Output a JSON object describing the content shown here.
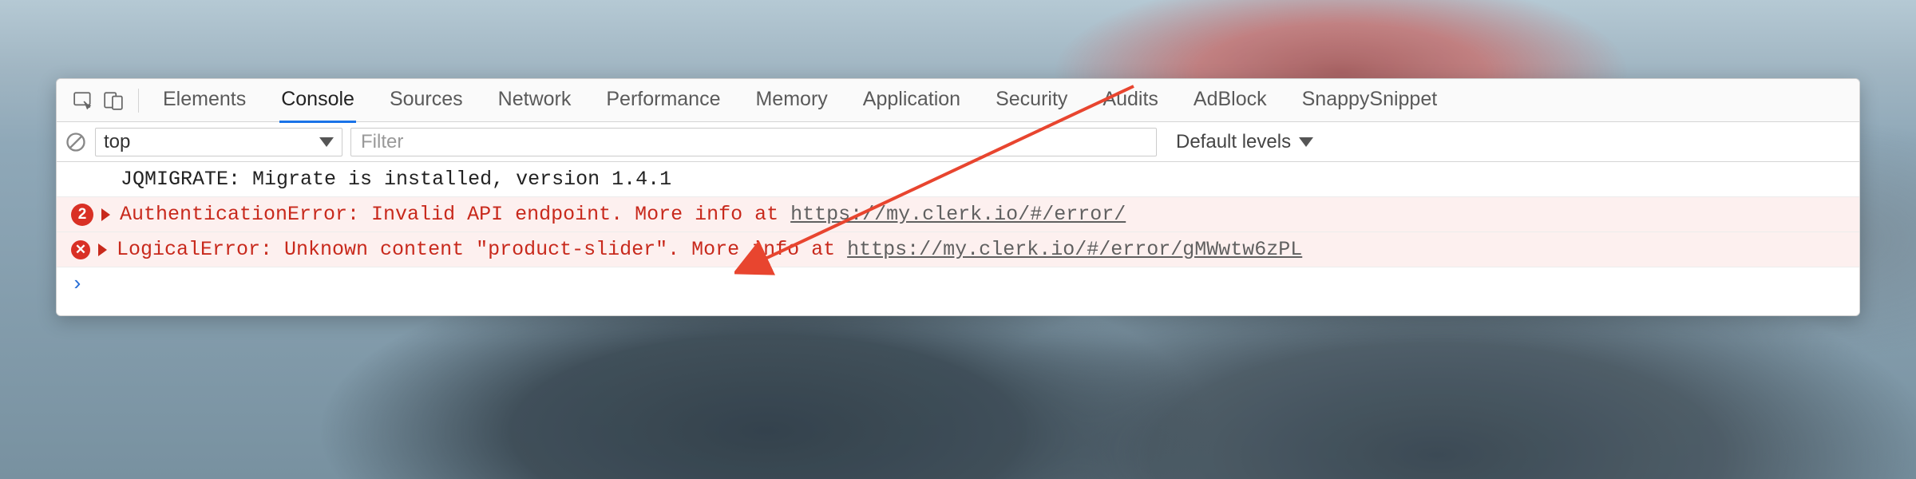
{
  "tabs": {
    "elements": "Elements",
    "console": "Console",
    "sources": "Sources",
    "network": "Network",
    "performance": "Performance",
    "memory": "Memory",
    "application": "Application",
    "security": "Security",
    "audits": "Audits",
    "adblock": "AdBlock",
    "snappysnippet": "SnappySnippet"
  },
  "toolbar": {
    "context": "top",
    "filter_placeholder": "Filter",
    "levels_label": "Default levels"
  },
  "console": {
    "rows": [
      {
        "type": "info",
        "text": "JQMIGRATE: Migrate is installed, version 1.4.1"
      },
      {
        "type": "error",
        "count": "2",
        "prefix": "AuthenticationError: Invalid API endpoint. More info at ",
        "link": "https://my.clerk.io/#/error/"
      },
      {
        "type": "error",
        "count": null,
        "prefix": "LogicalError: Unknown content \"product-slider\". More info at ",
        "link": "https://my.clerk.io/#/error/gMWwtw6zPL"
      }
    ],
    "prompt": "›"
  }
}
